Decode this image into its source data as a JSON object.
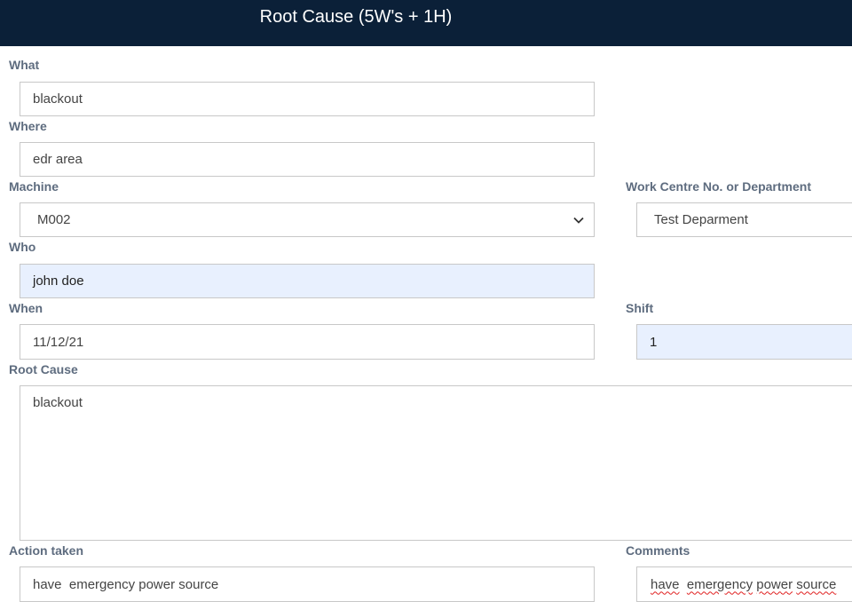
{
  "header": {
    "title": "Root Cause (5W's + 1H)"
  },
  "form": {
    "what": {
      "label": "What",
      "value": "blackout"
    },
    "where": {
      "label": "Where",
      "value": "edr area"
    },
    "machine": {
      "label": "Machine",
      "value": "M002",
      "icon": "chevron-down-icon"
    },
    "work_centre": {
      "label": "Work Centre No. or Department",
      "value": "Test Deparment"
    },
    "who": {
      "label": "Who",
      "value": "john doe"
    },
    "when": {
      "label": "When",
      "value": "11/12/21"
    },
    "shift": {
      "label": "Shift",
      "value": "1"
    },
    "root_cause": {
      "label": "Root Cause",
      "value": "blackout"
    },
    "action_taken": {
      "label": "Action taken",
      "value": "have  emergency power source"
    },
    "comments": {
      "label": "Comments",
      "value_words": [
        "have",
        "emergency",
        "power",
        "source"
      ]
    }
  },
  "colors": {
    "header_bg": "#0b2038",
    "label": "#5e6c7f",
    "autofill_bg": "#e8f0fe",
    "border": "#c8c8c8"
  }
}
